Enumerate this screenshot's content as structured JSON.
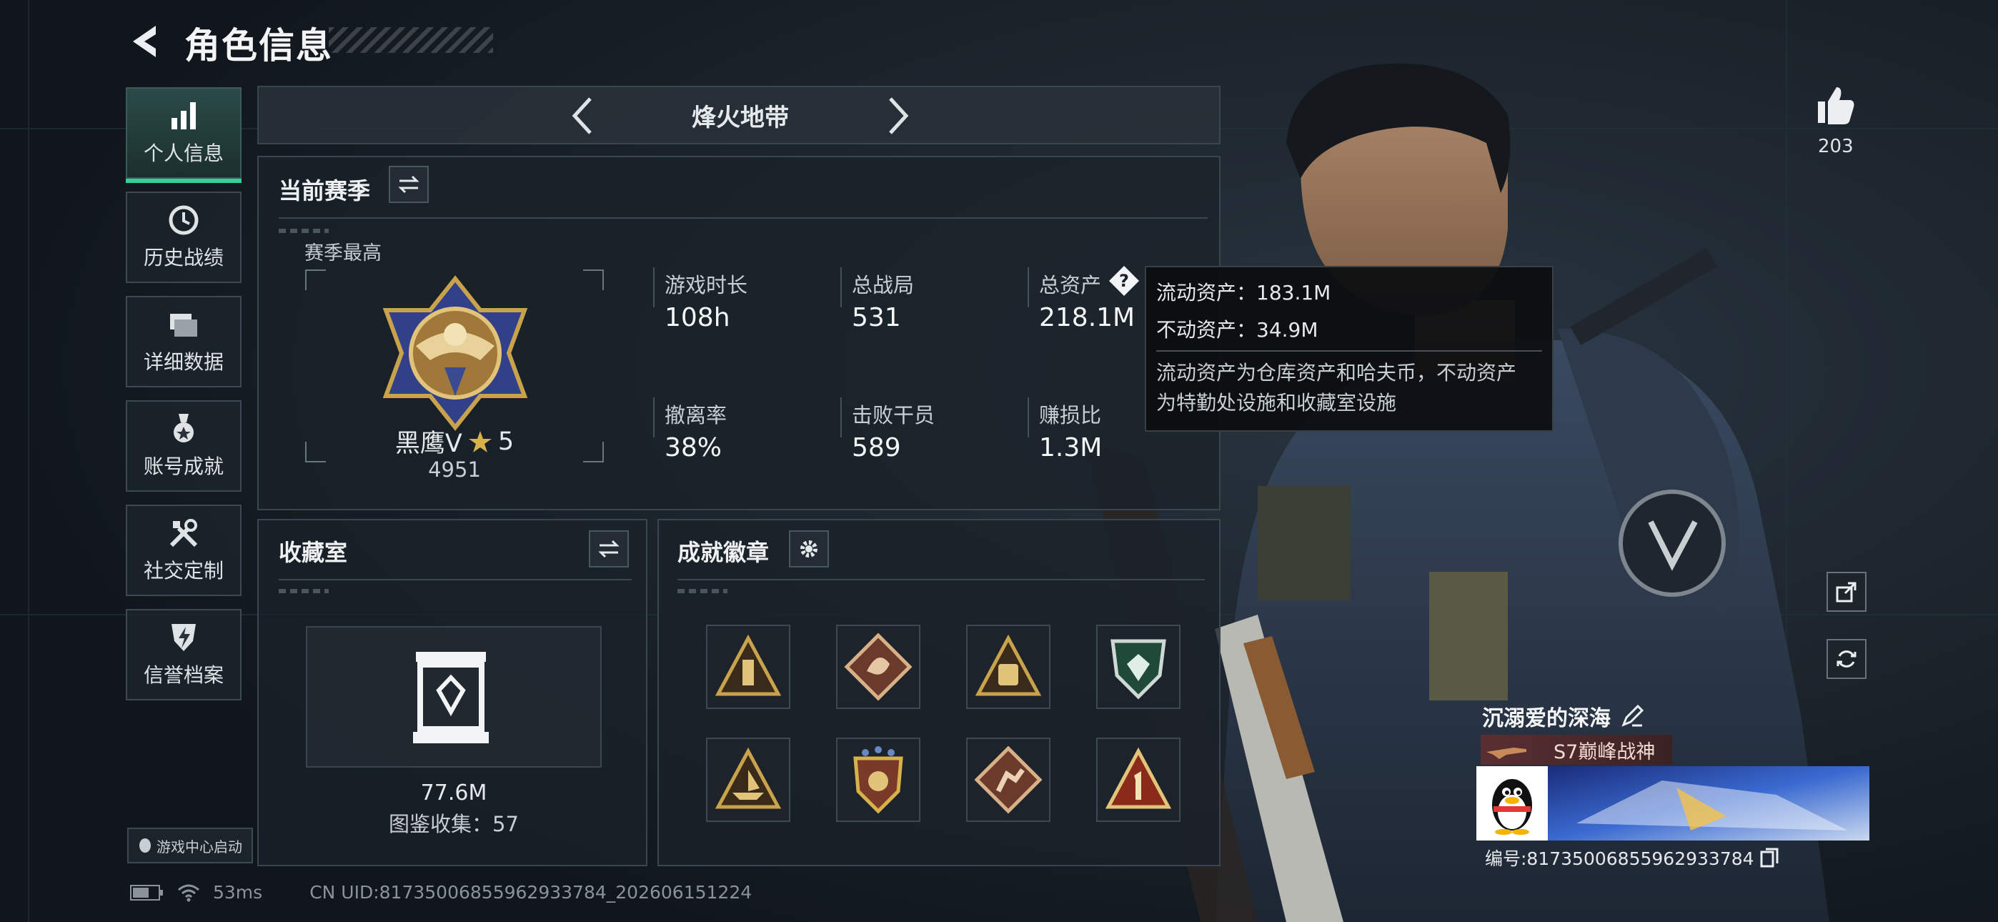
{
  "header": {
    "title": "角色信息"
  },
  "sidebar": {
    "items": [
      {
        "label": "个人信息",
        "icon": "bar-chart-icon",
        "active": true
      },
      {
        "label": "历史战绩",
        "icon": "history-clock-icon"
      },
      {
        "label": "详细数据",
        "icon": "folder-icon"
      },
      {
        "label": "账号成就",
        "icon": "achievement-medal-icon"
      },
      {
        "label": "社交定制",
        "icon": "tools-icon"
      },
      {
        "label": "信誉档案",
        "icon": "shield-bolt-icon"
      }
    ],
    "launch_label": "游戏中心启动"
  },
  "mode_selector": {
    "label": "烽火地带"
  },
  "season": {
    "title": "当前赛季",
    "best_label": "赛季最高",
    "rank_name": "黑鹰Ⅴ",
    "rank_stars": "5",
    "rank_points": "4951",
    "stats": [
      {
        "label": "游戏时长",
        "value": "108h"
      },
      {
        "label": "总战局",
        "value": "531"
      },
      {
        "label": "总资产",
        "value": "218.1M"
      },
      {
        "label": "撤离率",
        "value": "38%"
      },
      {
        "label": "击败干员",
        "value": "589"
      },
      {
        "label": "赚损比",
        "value": "1.3M"
      }
    ]
  },
  "tooltip": {
    "liquid": "流动资产：183.1M",
    "fixed": "不动资产：34.9M",
    "desc_line1": "流动资产为仓库资产和哈夫币，不动资产",
    "desc_line2": "为特勤处设施和收藏室设施"
  },
  "collection": {
    "title": "收藏室",
    "value": "77.6M",
    "catalog": "图鉴收集：57"
  },
  "achievements": {
    "title": "成就徽章",
    "badges": [
      "triangle-bottle-badge-icon",
      "diamond-dragon-badge-icon",
      "triangle-bag-badge-icon",
      "shield-gem-badge-icon",
      "triangle-ship-badge-icon",
      "shield-stars-badge-icon",
      "diamond-runner-badge-icon",
      "triangle-one-badge-icon"
    ]
  },
  "right": {
    "likes": "203",
    "player_name": "沉溺爱的深海",
    "player_title": "S7巅峰战神",
    "player_id": "编号:8173500685596293378​4"
  },
  "footer": {
    "ping": "53ms",
    "uid": "CN UID:81735006855962933784_202606151224"
  },
  "colors": {
    "accent": "#2fd39a",
    "bg": "#141c24",
    "panel": "#1a2129",
    "gold": "#c9a24c"
  }
}
